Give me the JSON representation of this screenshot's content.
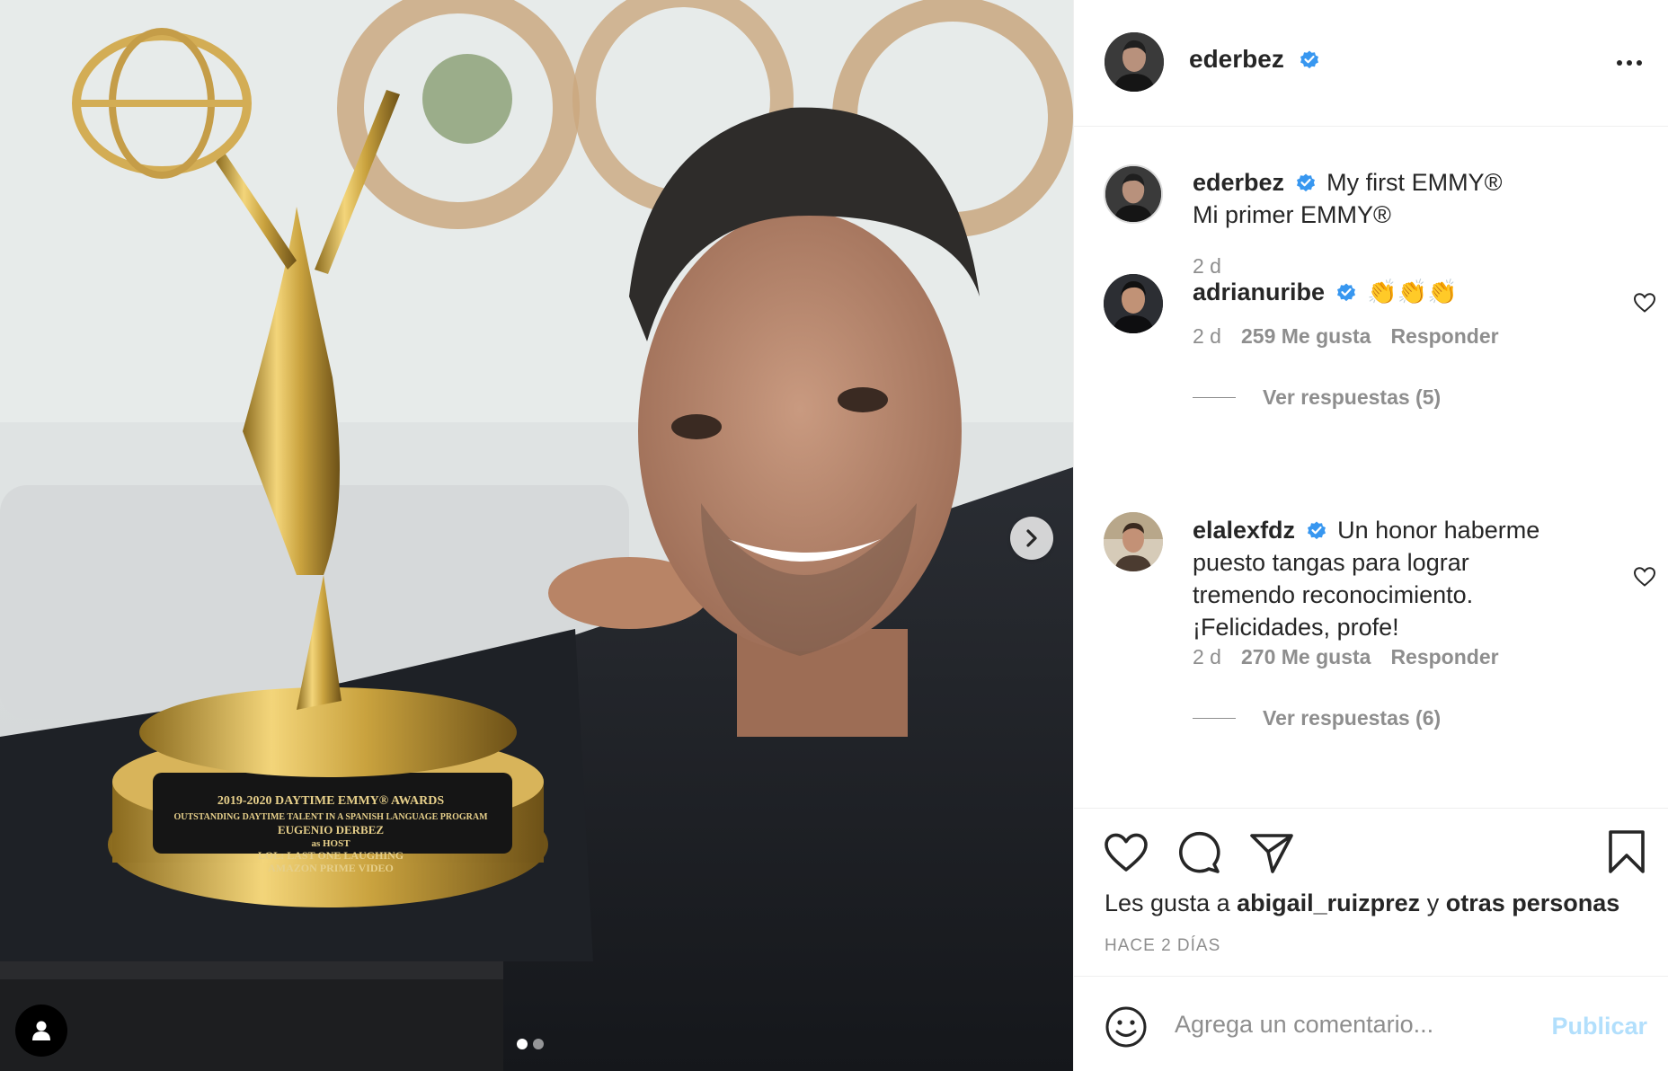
{
  "post": {
    "author": "ederbez",
    "caption_lines": [
      "My first EMMY®",
      "Mi primer EMMY®"
    ],
    "caption_time": "2 d",
    "image_count": 2,
    "active_image": 1
  },
  "comments": [
    {
      "username": "adrianuribe",
      "text": "👏👏👏",
      "time": "2 d",
      "likes": "259 Me gusta",
      "reply_label": "Responder",
      "view_replies": "Ver respuestas (5)"
    },
    {
      "username": "elalexfdz",
      "text_lines": [
        "Un honor haberme",
        "puesto tangas para lograr",
        "tremendo reconocimiento.",
        "¡Felicidades, profe!"
      ],
      "time": "2 d",
      "likes": "270 Me gusta",
      "reply_label": "Responder",
      "view_replies": "Ver respuestas (6)"
    }
  ],
  "likes_summary": {
    "prefix": "Les gusta a",
    "user": "abigail_ruizprez",
    "connector": "y",
    "others": "otras personas"
  },
  "timestamp": "HACE 2 DÍAS",
  "add_comment": {
    "placeholder": "Agrega un comentario...",
    "publish_label": "Publicar"
  },
  "trophy_plate": {
    "lines": [
      "2019-2020 DAYTIME EMMY® AWARDS",
      "OUTSTANDING DAYTIME TALENT IN A SPANISH LANGUAGE PROGRAM",
      "EUGENIO DERBEZ",
      "as HOST",
      "LOL: LAST ONE LAUGHING",
      "AMAZON PRIME VIDEO"
    ]
  },
  "colors": {
    "verified_blue": "#3897f0",
    "publish_disabled": "#b2dffc",
    "secondary_text": "#8e8e8e",
    "primary_text": "#262626"
  },
  "icons": [
    "more-options-icon",
    "verified-badge-icon",
    "heart-icon",
    "comment-icon",
    "share-icon",
    "bookmark-icon",
    "emoji-icon",
    "next-arrow-icon",
    "user-tag-icon"
  ]
}
